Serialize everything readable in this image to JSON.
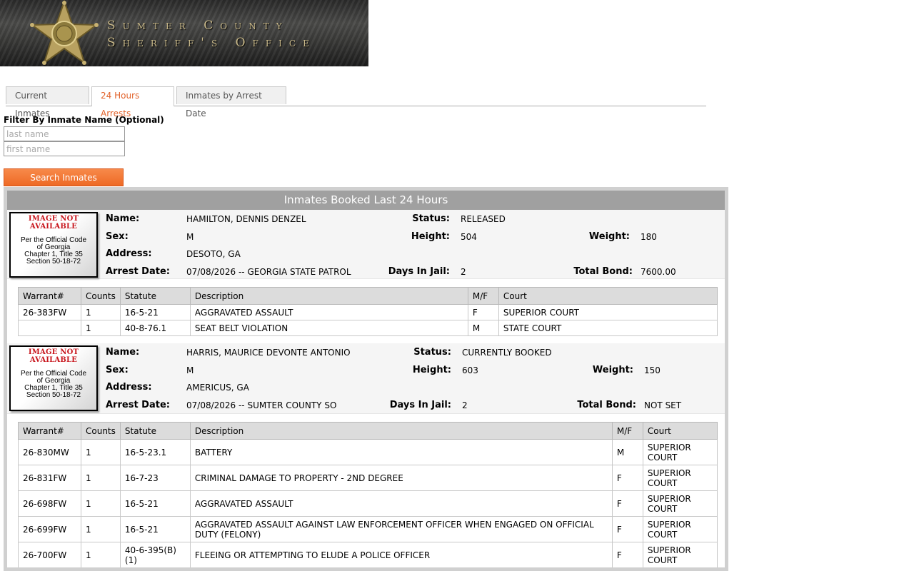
{
  "banner": {
    "line1": "Sumter County",
    "line2": "Sheriff's Office"
  },
  "tabs": [
    {
      "label": "Current Inmates",
      "active": false
    },
    {
      "label": "24 Hours Arrests",
      "active": true
    },
    {
      "label": "Inmates by Arrest Date",
      "active": false
    }
  ],
  "filter": {
    "label": "Filter By Inmate Name (Optional)",
    "last_placeholder": "last name",
    "first_placeholder": "first name",
    "button": "Search Inmates"
  },
  "results": {
    "title": "Inmates Booked Last 24 Hours"
  },
  "labels": {
    "name": "Name:",
    "sex": "Sex:",
    "address": "Address:",
    "arrest_date": "Arrest Date:",
    "status": "Status:",
    "height": "Height:",
    "days": "Days In Jail:",
    "weight": "Weight:",
    "bond": "Total Bond:"
  },
  "no_image": {
    "title": "IMAGE NOT AVAILABLE",
    "l1": "Per the Official Code",
    "l2": "of Georgia",
    "l3": "Chapter 1, Title 35",
    "l4": "Section 50-18-72"
  },
  "warrant_headers": [
    "Warrant#",
    "Counts",
    "Statute",
    "Description",
    "M/F",
    "Court"
  ],
  "inmates": [
    {
      "name": "HAMILTON, DENNIS DENZEL",
      "sex": "M",
      "address": "DESOTO, GA",
      "arrest_date": "07/08/2026 -- GEORGIA STATE PATROL",
      "status": "RELEASED",
      "height": "504",
      "days": "2",
      "weight": "180",
      "bond": "7600.00",
      "warrants": [
        [
          "26-383FW",
          "1",
          "16-5-21",
          "AGGRAVATED ASSAULT",
          "F",
          "SUPERIOR COURT"
        ],
        [
          "",
          "1",
          "40-8-76.1",
          "SEAT BELT VIOLATION",
          "M",
          "STATE COURT"
        ]
      ]
    },
    {
      "name": "HARRIS, MAURICE DEVONTE ANTONIO",
      "sex": "M",
      "address": "AMERICUS, GA",
      "arrest_date": "07/08/2026 -- SUMTER COUNTY SO",
      "status": "CURRENTLY BOOKED",
      "height": "603",
      "days": "2",
      "weight": "150",
      "bond": "NOT SET",
      "warrants": [
        [
          "26-830MW",
          "1",
          "16-5-23.1",
          "BATTERY",
          "M",
          "SUPERIOR COURT"
        ],
        [
          "26-831FW",
          "1",
          "16-7-23",
          "CRIMINAL DAMAGE TO PROPERTY - 2ND DEGREE",
          "F",
          "SUPERIOR COURT"
        ],
        [
          "26-698FW",
          "1",
          "16-5-21",
          "AGGRAVATED ASSAULT",
          "F",
          "SUPERIOR COURT"
        ],
        [
          "26-699FW",
          "1",
          "16-5-21",
          "AGGRAVATED ASSAULT AGAINST LAW ENFORCEMENT OFFICER WHEN ENGAGED ON OFFICIAL DUTY (FELONY)",
          "F",
          "SUPERIOR COURT"
        ],
        [
          "26-700FW",
          "1",
          "40-6-395(B)(1)",
          "FLEEING OR ATTEMPTING TO ELUDE A POLICE OFFICER",
          "F",
          "SUPERIOR COURT"
        ]
      ]
    }
  ]
}
